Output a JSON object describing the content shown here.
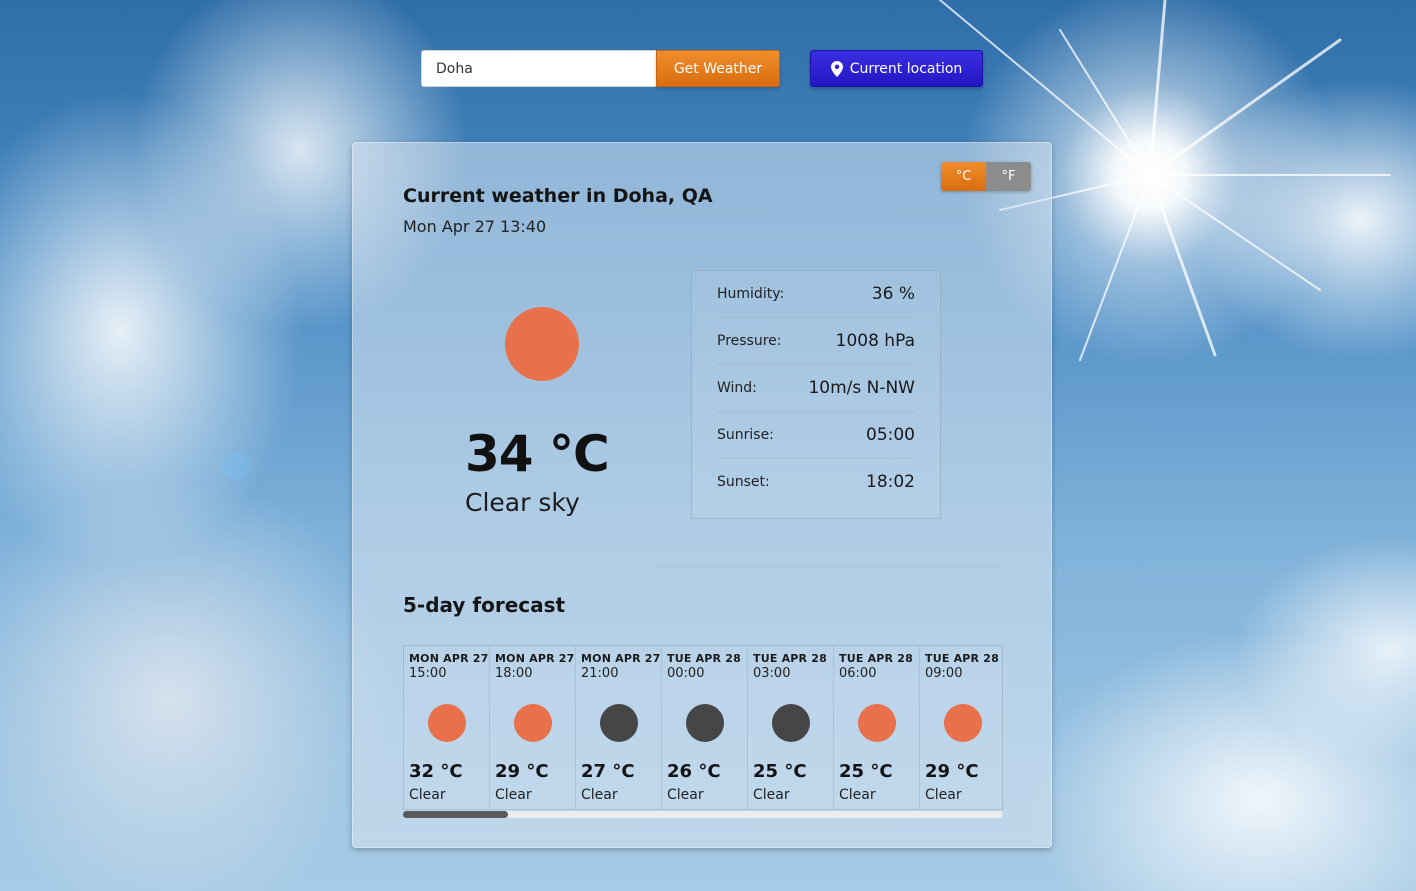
{
  "search": {
    "value": "Doha",
    "button_label": "Get Weather"
  },
  "location_button": {
    "label": "Current location",
    "icon": "map-pin-icon"
  },
  "units": {
    "celsius_label": "°C",
    "fahrenheit_label": "°F",
    "active": "celsius"
  },
  "current": {
    "title": "Current weather in Doha, QA",
    "datetime": "Mon Apr 27 13:40",
    "icon": "sun-icon",
    "temperature": "34 °C",
    "description": "Clear sky",
    "details": [
      {
        "label": "Humidity:",
        "value": "36 %"
      },
      {
        "label": "Pressure:",
        "value": "1008 hPa"
      },
      {
        "label": "Wind:",
        "value": "10m/s N-NW"
      },
      {
        "label": "Sunrise:",
        "value": "05:00"
      },
      {
        "label": "Sunset:",
        "value": "18:02"
      }
    ]
  },
  "forecast": {
    "title": "5-day forecast",
    "items": [
      {
        "day": "MON APR 27",
        "time": "15:00",
        "icon": "sun-icon",
        "temp": "32 °C",
        "desc": "Clear"
      },
      {
        "day": "MON APR 27",
        "time": "18:00",
        "icon": "sun-icon",
        "temp": "29 °C",
        "desc": "Clear"
      },
      {
        "day": "MON APR 27",
        "time": "21:00",
        "icon": "moon-icon",
        "temp": "27 °C",
        "desc": "Clear"
      },
      {
        "day": "TUE APR 28",
        "time": "00:00",
        "icon": "moon-icon",
        "temp": "26 °C",
        "desc": "Clear"
      },
      {
        "day": "TUE APR 28",
        "time": "03:00",
        "icon": "moon-icon",
        "temp": "25 °C",
        "desc": "Clear"
      },
      {
        "day": "TUE APR 28",
        "time": "06:00",
        "icon": "sun-icon",
        "temp": "25 °C",
        "desc": "Clear"
      },
      {
        "day": "TUE APR 28",
        "time": "09:00",
        "icon": "sun-icon",
        "temp": "29 °C",
        "desc": "Clear"
      }
    ],
    "scroll_position": 0
  },
  "colors": {
    "accent_orange": "#e07a1a",
    "location_blue": "#2a1fd6",
    "day_icon": "#e8704b",
    "night_icon": "#464646"
  }
}
